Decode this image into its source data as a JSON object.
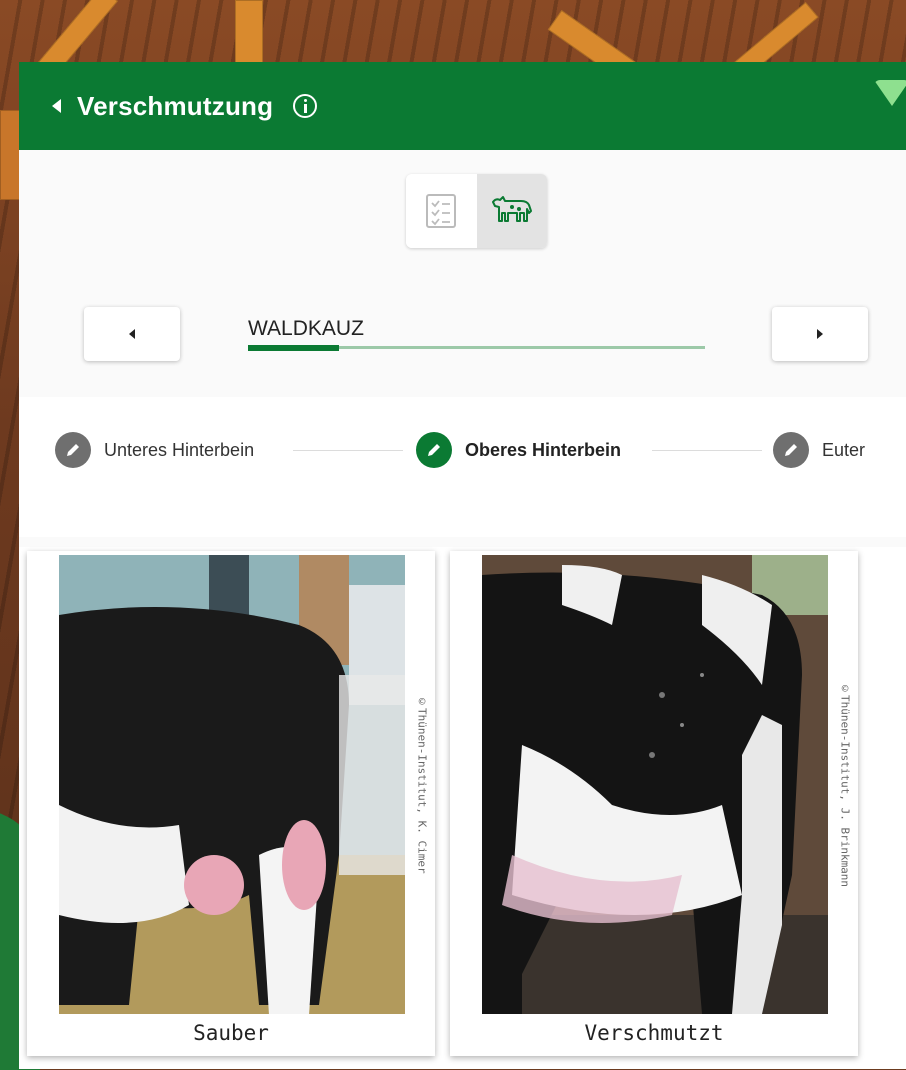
{
  "header": {
    "title": "Verschmutzung"
  },
  "view_toggle": {
    "options": [
      "list",
      "cow"
    ],
    "selected": "cow"
  },
  "animal": {
    "name": "WALDKAUZ",
    "progress": 0.2
  },
  "steps": [
    {
      "label": "Unteres Hinterbein",
      "state": "done"
    },
    {
      "label": "Oberes Hinterbein",
      "state": "active"
    },
    {
      "label": "Euter",
      "state": "pending"
    }
  ],
  "cards": [
    {
      "caption": "Sauber",
      "credit": "©Thünen-Institut, K. Cimer"
    },
    {
      "caption": "Verschmutzt",
      "credit": "©Thünen-Institut, J. Brinkmann"
    }
  ],
  "colors": {
    "brand_green": "#0b7a33",
    "step_inactive": "#6f6f6f",
    "progress_track": "#9cc9a8"
  }
}
